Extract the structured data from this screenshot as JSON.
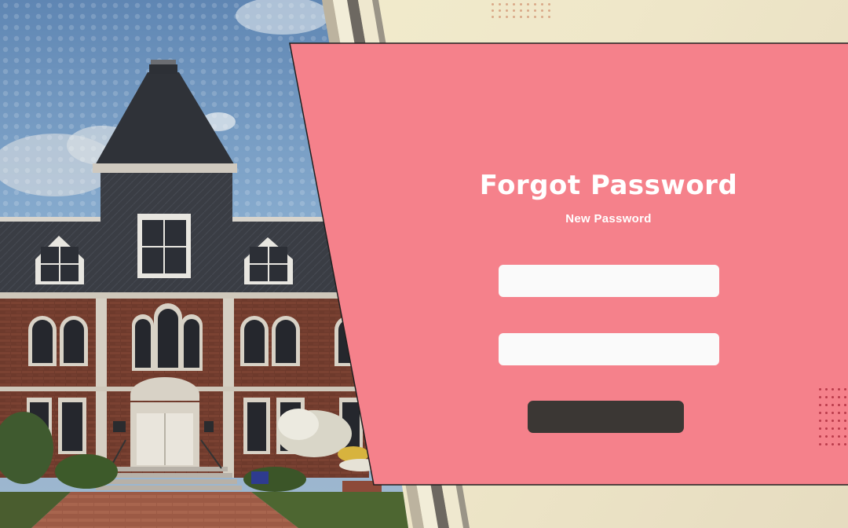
{
  "form": {
    "title": "Forgot Password",
    "subtitle": "New Password",
    "new_password_value": "",
    "confirm_password_value": "",
    "submit_label": ""
  },
  "colors": {
    "card": "#f5818b",
    "button": "#3b3734",
    "field": "#fafafa",
    "background": "#f4efcf"
  },
  "icons": {
    "hero_image": "campus-building-photo"
  }
}
